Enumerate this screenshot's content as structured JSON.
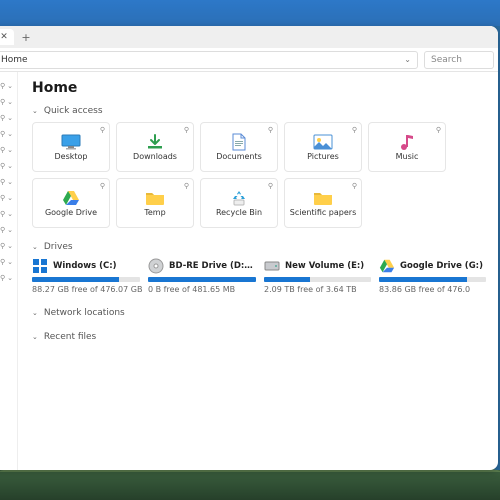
{
  "colors": {
    "accent": "#1976d2",
    "folder": "#ffcf4a",
    "folder_shade": "#e8b93a"
  },
  "tabbar": {
    "close_glyph": "✕",
    "newtab_glyph": "+"
  },
  "addressbar": {
    "breadcrumb": "Home",
    "search_placeholder": "Search"
  },
  "page": {
    "title": "Home"
  },
  "sections": {
    "quick_access": {
      "label": "Quick access"
    },
    "drives": {
      "label": "Drives"
    },
    "network": {
      "label": "Network locations"
    },
    "recent": {
      "label": "Recent files"
    }
  },
  "quick_access": [
    {
      "label": "Desktop",
      "icon": "desktop"
    },
    {
      "label": "Downloads",
      "icon": "downloads"
    },
    {
      "label": "Documents",
      "icon": "documents"
    },
    {
      "label": "Pictures",
      "icon": "pictures"
    },
    {
      "label": "Music",
      "icon": "music"
    },
    {
      "label": "Google Drive",
      "icon": "gdrive"
    },
    {
      "label": "Temp",
      "icon": "folder"
    },
    {
      "label": "Recycle Bin",
      "icon": "recycle"
    },
    {
      "label": "Scientific papers",
      "icon": "folder"
    }
  ],
  "drives": [
    {
      "name": "Windows (C:)",
      "free": "88.27 GB free of 476.07 GB",
      "fill_pct": 81,
      "icon": "windows"
    },
    {
      "name": "BD-RE Drive (D:) CyberLink",
      "free": "0 B free of 481.65 MB",
      "fill_pct": 100,
      "icon": "disc"
    },
    {
      "name": "New Volume (E:)",
      "free": "2.09 TB free of 3.64 TB",
      "fill_pct": 43,
      "icon": "hdd"
    },
    {
      "name": "Google Drive (G:)",
      "free": "83.86 GB free of 476.0",
      "fill_pct": 82,
      "icon": "gdrive"
    }
  ],
  "sidebar_rows": 13
}
